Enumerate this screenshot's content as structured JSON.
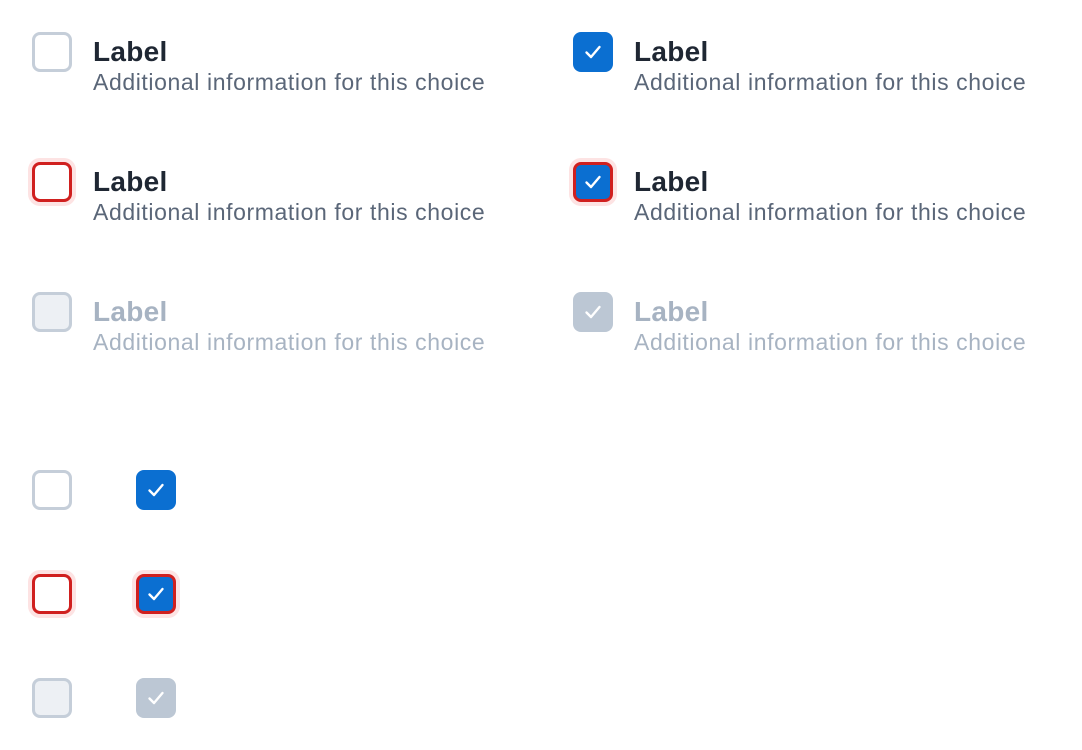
{
  "rows": [
    {
      "left": {
        "state": "unchecked",
        "label": "Label",
        "description": "Additional information for this choice"
      },
      "right": {
        "state": "checked",
        "label": "Label",
        "description": "Additional information for this choice"
      }
    },
    {
      "left": {
        "state": "error-unchecked",
        "label": "Label",
        "description": "Additional information for this choice"
      },
      "right": {
        "state": "error-checked",
        "label": "Label",
        "description": "Additional information for this choice"
      }
    },
    {
      "left": {
        "state": "disabled-unchecked",
        "label": "Label",
        "description": "Additional information for this choice"
      },
      "right": {
        "state": "disabled-checked",
        "label": "Label",
        "description": "Additional information for this choice"
      }
    }
  ],
  "standalone": [
    {
      "left_state": "unchecked",
      "right_state": "checked"
    },
    {
      "left_state": "error-unchecked",
      "right_state": "error-checked"
    },
    {
      "left_state": "disabled-unchecked",
      "right_state": "disabled-checked"
    }
  ],
  "colors": {
    "checked_fill": "#0b6fd1",
    "error_border": "#d0201f",
    "unchecked_border": "#c5ced9",
    "disabled_fill": "#bcc7d4",
    "label_text": "#1f2733",
    "description_text": "#5a6678",
    "disabled_text": "#a7b3c2"
  },
  "icons": {
    "check": "check-icon"
  }
}
